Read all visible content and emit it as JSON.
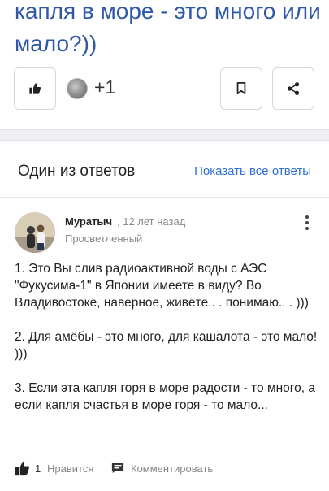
{
  "question": {
    "title": "капля в море - это много или мало?))",
    "likes_count": "+1"
  },
  "answers_section": {
    "title": "Один из ответов",
    "show_all_label": "Показать все ответы"
  },
  "answer": {
    "author": "Муратыч",
    "meta": ", 12 лет назад",
    "rank": "Просветленный",
    "paragraphs": [
      "1. Это Вы слив радиоактивной воды с АЭС \"Фукусима-1\" в Японии имеете в виду? Во Владивостоке, наверное, живёте.. . понимаю.. . )))",
      "2. Для амёбы - это много, для кашалота - это мало! )))",
      "3. Если эта капля горя в море радости - то много, а если капля счастья в море горя - то мало..."
    ],
    "likes": "1",
    "like_label": "Нравится",
    "comment_label": "Комментировать"
  },
  "colors": {
    "title_blue": "#2f58a8",
    "link_blue": "#2f6fd6",
    "muted": "#888888"
  }
}
